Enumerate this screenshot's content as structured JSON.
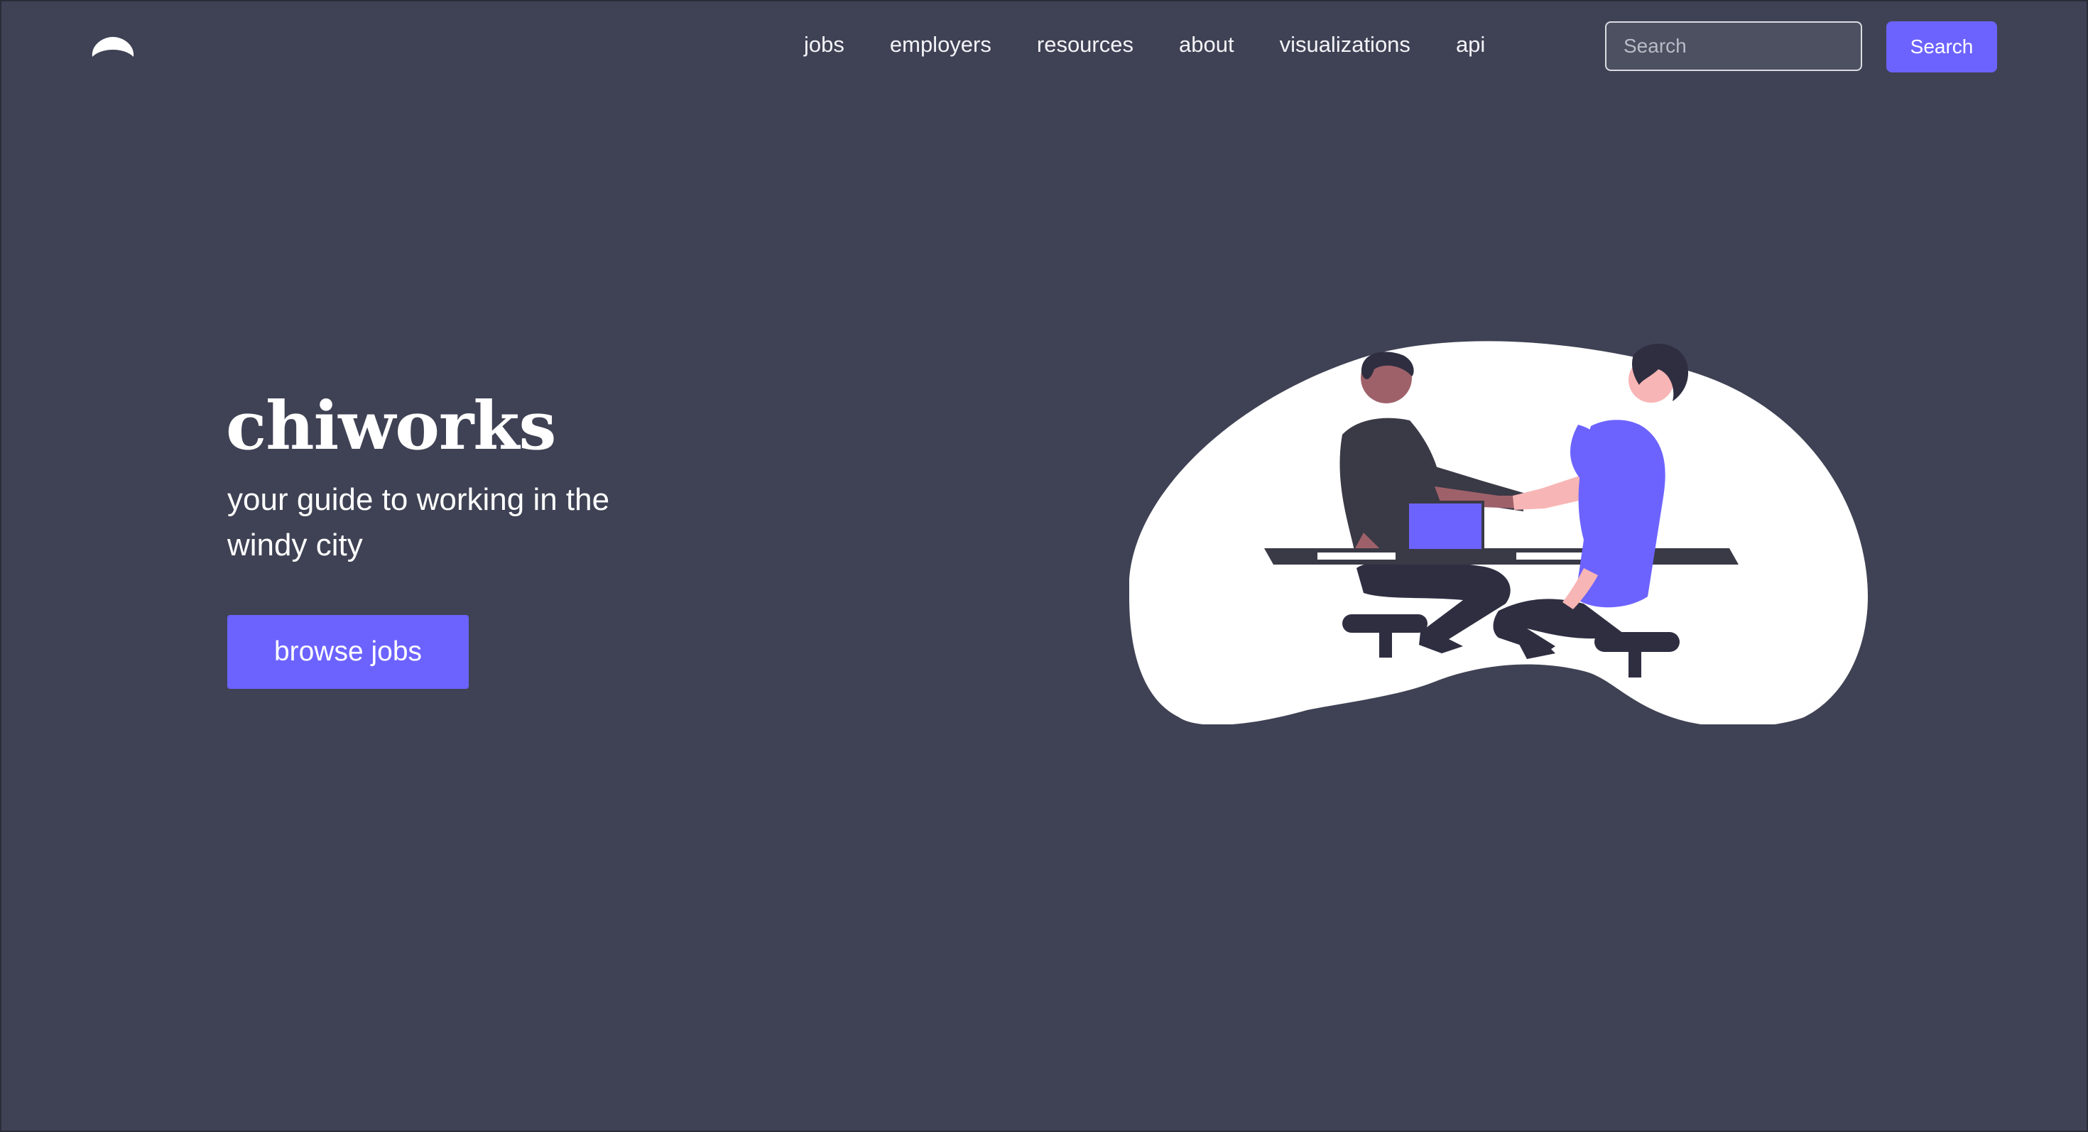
{
  "header": {
    "logo_icon": "chiworks-logo-icon",
    "nav": [
      {
        "label": "jobs"
      },
      {
        "label": "employers"
      },
      {
        "label": "resources"
      },
      {
        "label": "about"
      },
      {
        "label": "visualizations"
      },
      {
        "label": "api"
      }
    ],
    "search": {
      "placeholder": "Search",
      "value": "",
      "button_label": "Search"
    }
  },
  "hero": {
    "title": "chiworks",
    "subtitle": "your guide to working in the windy city",
    "cta_label": "browse jobs",
    "illustration_icon": "handshake-illustration"
  },
  "colors": {
    "background": "#3f4254",
    "accent": "#6c63ff",
    "text": "#ffffff",
    "blob": "#ffffff",
    "dark_figure": "#2f2e41",
    "skin_dark": "#9e616a",
    "skin_light": "#f8b5b5"
  }
}
